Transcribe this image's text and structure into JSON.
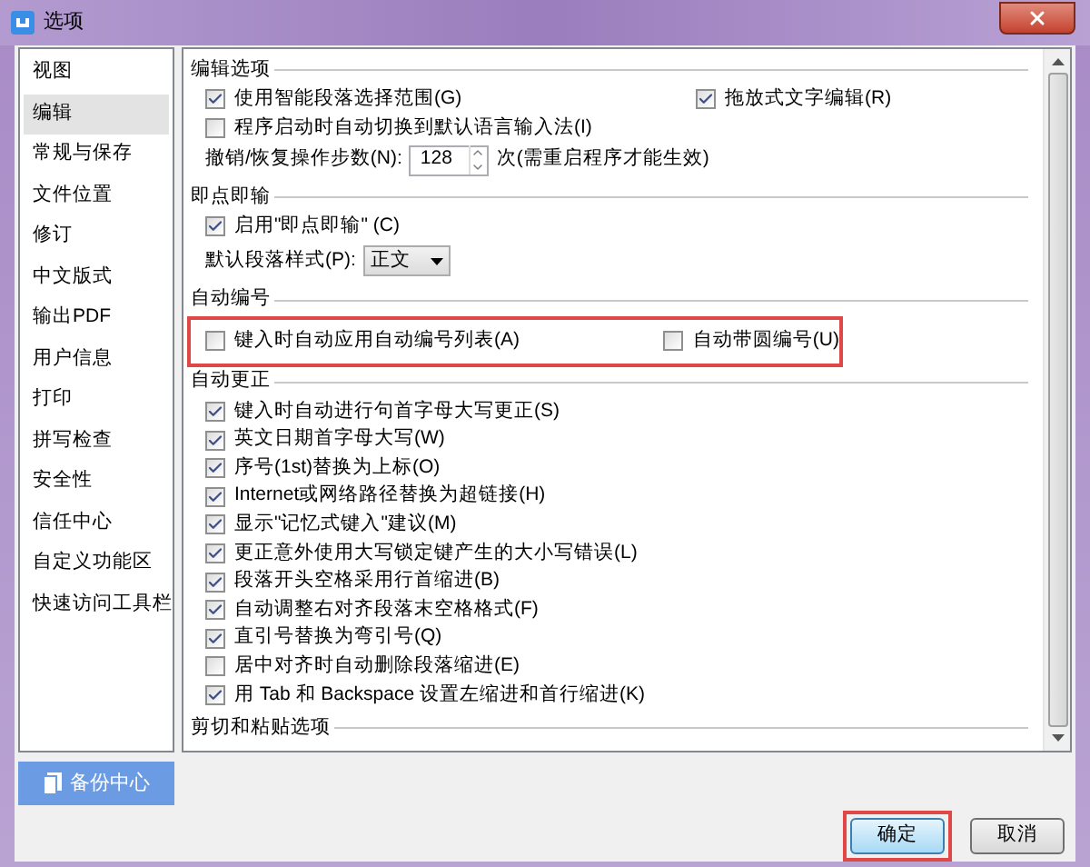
{
  "window": {
    "title": "选项"
  },
  "sidebar": {
    "items": [
      {
        "label": "视图",
        "selected": false
      },
      {
        "label": "编辑",
        "selected": true
      },
      {
        "label": "常规与保存",
        "selected": false
      },
      {
        "label": "文件位置",
        "selected": false
      },
      {
        "label": "修订",
        "selected": false
      },
      {
        "label": "中文版式",
        "selected": false
      },
      {
        "label": "输出PDF",
        "selected": false
      },
      {
        "label": "用户信息",
        "selected": false
      },
      {
        "label": "打印",
        "selected": false
      },
      {
        "label": "拼写检查",
        "selected": false
      },
      {
        "label": "安全性",
        "selected": false
      },
      {
        "label": "信任中心",
        "selected": false
      },
      {
        "label": "自定义功能区",
        "selected": false
      },
      {
        "label": "快速访问工具栏",
        "selected": false
      }
    ]
  },
  "sections": [
    {
      "title": "编辑选项",
      "highlighted": false,
      "rows": [
        {
          "kind": "pair",
          "items": [
            {
              "label": "使用智能段落选择范围(G)",
              "checked": true
            },
            {
              "label": "拖放式文字编辑(R)",
              "checked": true
            }
          ]
        },
        {
          "kind": "checkbox",
          "label": "程序启动时自动切换到默认语言输入法(I)",
          "checked": false
        },
        {
          "kind": "spinner",
          "label": "撤销/恢复操作步数(N):",
          "value": "128",
          "suffix": "次(需重启程序才能生效)"
        }
      ]
    },
    {
      "title": "即点即输",
      "highlighted": false,
      "rows": [
        {
          "kind": "checkbox",
          "label": "启用\"即点即输\" (C)",
          "checked": true
        },
        {
          "kind": "dropdown",
          "label": "默认段落样式(P):",
          "value": "正文"
        }
      ]
    },
    {
      "title": "自动编号",
      "highlighted": true,
      "rows": [
        {
          "kind": "pair",
          "items": [
            {
              "label": "键入时自动应用自动编号列表(A)",
              "checked": false
            },
            {
              "label": "自动带圆编号(U)",
              "checked": false
            }
          ]
        }
      ]
    },
    {
      "title": "自动更正",
      "highlighted": false,
      "rows": [
        {
          "kind": "checkbox",
          "label": "键入时自动进行句首字母大写更正(S)",
          "checked": true
        },
        {
          "kind": "checkbox",
          "label": "英文日期首字母大写(W)",
          "checked": true
        },
        {
          "kind": "checkbox",
          "label": "序号(1st)替换为上标(O)",
          "checked": true
        },
        {
          "kind": "checkbox",
          "label": "Internet或网络路径替换为超链接(H)",
          "checked": true
        },
        {
          "kind": "checkbox",
          "label": "显示\"记忆式键入\"建议(M)",
          "checked": true
        },
        {
          "kind": "checkbox",
          "label": "更正意外使用大写锁定键产生的大小写错误(L)",
          "checked": true
        },
        {
          "kind": "checkbox",
          "label": "段落开头空格采用行首缩进(B)",
          "checked": true
        },
        {
          "kind": "checkbox",
          "label": "自动调整右对齐段落末空格格式(F)",
          "checked": true
        },
        {
          "kind": "checkbox",
          "label": "直引号替换为弯引号(Q)",
          "checked": true
        },
        {
          "kind": "checkbox",
          "label": "居中对齐时自动删除段落缩进(E)",
          "checked": false
        },
        {
          "kind": "checkbox",
          "label": "用 Tab 和 Backspace 设置左缩进和首行缩进(K)",
          "checked": true
        }
      ]
    },
    {
      "title": "剪切和粘贴选项",
      "highlighted": false
    }
  ],
  "backup_button": {
    "label": "备份中心"
  },
  "buttons": [
    {
      "label": "确定",
      "default": true,
      "highlighted": true
    },
    {
      "label": "取消",
      "default": false,
      "highlighted": false
    }
  ]
}
